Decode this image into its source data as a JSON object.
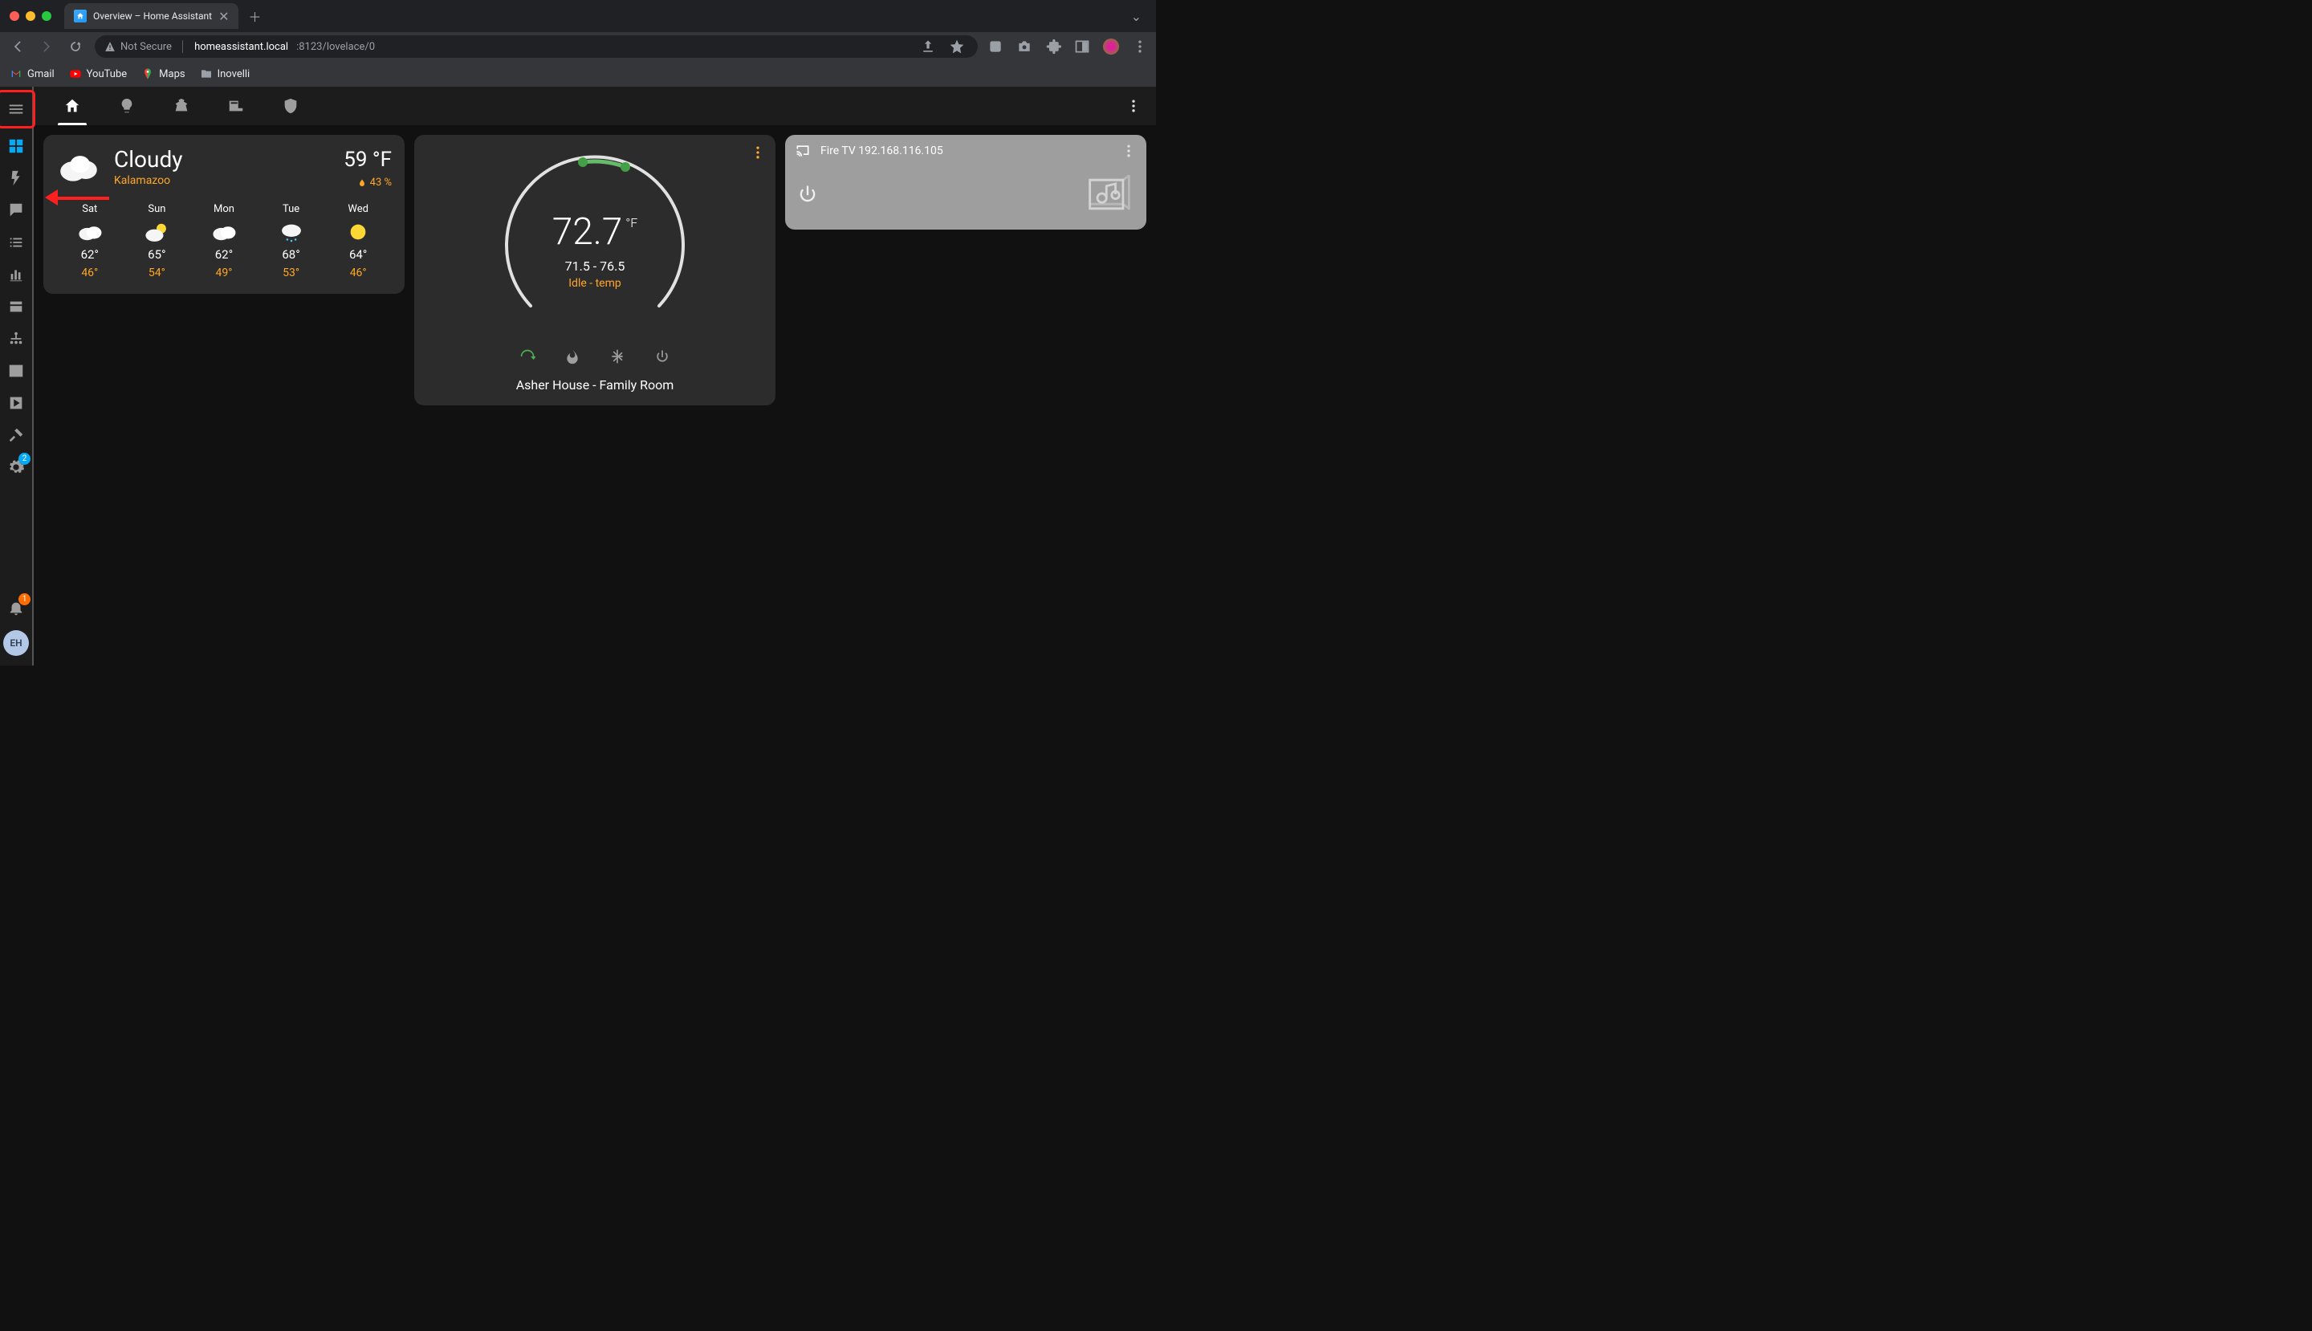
{
  "browser": {
    "tab_title": "Overview – Home Assistant",
    "address_insecure": "Not Secure",
    "address_host": "homeassistant.local",
    "address_port_path": ":8123/lovelace/0",
    "bookmarks": [
      "Gmail",
      "YouTube",
      "Maps",
      "Inovelli"
    ]
  },
  "sidebar": {
    "settings_badge": "2",
    "notify_badge": "1",
    "user_initials": "EH"
  },
  "weather": {
    "condition": "Cloudy",
    "location": "Kalamazoo",
    "temp": "59 °F",
    "humidity": "43 %",
    "forecast": [
      {
        "day": "Sat",
        "hi": "62°",
        "lo": "46°",
        "icon": "cloudy"
      },
      {
        "day": "Sun",
        "hi": "65°",
        "lo": "54°",
        "icon": "partly"
      },
      {
        "day": "Mon",
        "hi": "62°",
        "lo": "49°",
        "icon": "cloudy"
      },
      {
        "day": "Tue",
        "hi": "68°",
        "lo": "53°",
        "icon": "rainy"
      },
      {
        "day": "Wed",
        "hi": "64°",
        "lo": "46°",
        "icon": "sunny"
      }
    ]
  },
  "thermostat": {
    "current": "72.7",
    "unit": "°F",
    "range": "71.5 - 76.5",
    "mode": "Idle - temp",
    "name": "Asher House - Family Room"
  },
  "media": {
    "name": "Fire TV 192.168.116.105"
  }
}
